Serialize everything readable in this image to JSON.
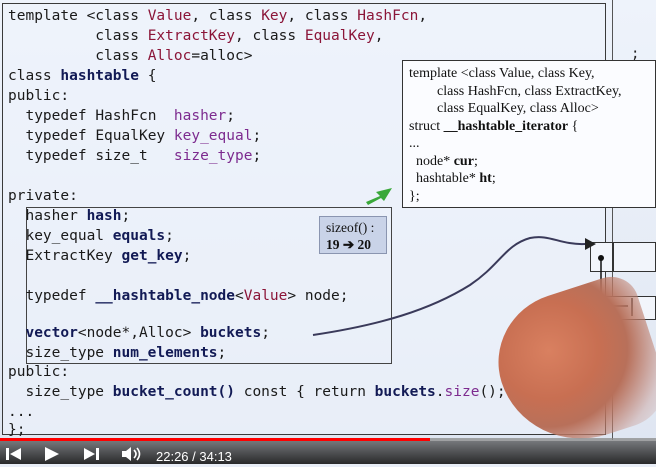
{
  "code": {
    "l1": {
      "a": "template <class ",
      "b": "Value",
      "c": ", class ",
      "d": "Key",
      "e": ", class ",
      "f": "HashFcn",
      "g": ","
    },
    "l2": {
      "a": "          class ",
      "b": "ExtractKey",
      "c": ", class ",
      "d": "EqualKey",
      "e": ","
    },
    "l3": {
      "a": "          class ",
      "b": "Alloc",
      "c": "=alloc>"
    },
    "l4": {
      "a": "class ",
      "b": "hashtable",
      "c": " {"
    },
    "l5": "public:",
    "l6": {
      "a": "  typedef ",
      "b": "HashFcn",
      "c": "  ",
      "d": "hasher",
      "e": ";"
    },
    "l7": {
      "a": "  typedef ",
      "b": "EqualKey",
      "c": " ",
      "d": "key_equal",
      "e": ";"
    },
    "l8": {
      "a": "  typedef ",
      "b": "size_t",
      "c": "   ",
      "d": "size_type",
      "e": ";"
    },
    "l9": "private:",
    "l10": {
      "a": "  hasher ",
      "b": "hash",
      "c": ";"
    },
    "l11": {
      "a": "  key_equal ",
      "b": "equals",
      "c": ";"
    },
    "l12": {
      "a": "  ExtractKey ",
      "b": "get_key",
      "c": ";"
    },
    "l13": {
      "a": "  typedef ",
      "b": "__hashtable_node",
      "c": "<",
      "d": "Value",
      "e": "> node;"
    },
    "l14": {
      "a": "  ",
      "b": "vector",
      "c": "<node*,Alloc> ",
      "d": "buckets",
      "e": ";"
    },
    "l15": {
      "a": "  size_type ",
      "b": "num_elements",
      "c": ";"
    },
    "l16": "public:",
    "l17": {
      "a": "  size_type ",
      "b": "bucket_count()",
      "c": " const { return ",
      "d": "buckets",
      "e": ".",
      "f": "size",
      "g": "(); }"
    },
    "l18": "...",
    "l19": "};"
  },
  "sizeof_note": {
    "line1": "sizeof() :",
    "line2": "19 ➔ 20"
  },
  "iterator_box": {
    "l1": "template <class Value, class Key,",
    "l2": "        class HashFcn, class ExtractKey,",
    "l3": "        class EqualKey, class Alloc>",
    "l4a": "struct ",
    "l4b": "__hashtable_iterator",
    "l4c": " {",
    "l5": "...",
    "l6a": "  node* ",
    "l6b": "cur",
    "l6c": ";",
    "l7a": "  hashtable* ",
    "l7b": "ht",
    "l7c": ";",
    "l8": "};"
  },
  "right_panel": {
    "semicolon": ";"
  },
  "player": {
    "time_label": "22:26 / 34:13",
    "progress": 0.656,
    "accent": "#ff0000"
  }
}
